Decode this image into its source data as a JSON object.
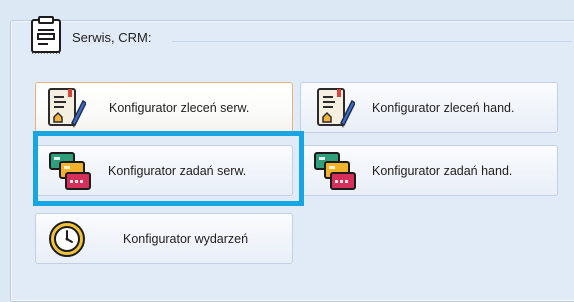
{
  "group": {
    "title": "Serwis, CRM:",
    "icon": "form-document-icon"
  },
  "buttons": [
    {
      "id": "zlecen-serw",
      "label": "Konfigurator zleceń serw.",
      "icon": "document-pen-icon",
      "state": "hover"
    },
    {
      "id": "zlecen-hand",
      "label": "Konfigurator zleceń hand.",
      "icon": "document-pen-icon",
      "state": "normal"
    },
    {
      "id": "zadan-serw",
      "label": "Konfigurator zadań serw.",
      "icon": "stacked-cards-icon",
      "state": "highlighted"
    },
    {
      "id": "zadan-hand",
      "label": "Konfigurator zadań hand.",
      "icon": "stacked-cards-icon",
      "state": "normal"
    },
    {
      "id": "wydarzen",
      "label": "Konfigurator wydarzeń",
      "icon": "clock-icon",
      "state": "normal"
    }
  ],
  "colors": {
    "highlight": "#18a6e3",
    "hover_border": "#e9b27a",
    "panel_bg": "#e1ebf7"
  }
}
